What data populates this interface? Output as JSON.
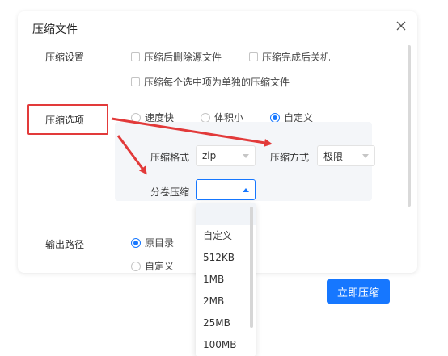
{
  "dialog": {
    "title": "压缩文件",
    "close_icon": "close-icon"
  },
  "settings": {
    "label": "压缩设置",
    "checkboxes": [
      {
        "label": "压缩后删除源文件",
        "checked": false
      },
      {
        "label": "压缩完成后关机",
        "checked": false
      },
      {
        "label": "压缩每个选中项为单独的压缩文件",
        "checked": false
      }
    ]
  },
  "options": {
    "label": "压缩选项",
    "radios": [
      {
        "label": "速度快",
        "selected": false
      },
      {
        "label": "体积小",
        "selected": false
      },
      {
        "label": "自定义",
        "selected": true
      }
    ],
    "format_label": "压缩格式",
    "format_value": "zip",
    "method_label": "压缩方式",
    "method_value": "极限",
    "split_label": "分卷压缩",
    "split_value": ""
  },
  "split_dropdown": {
    "items": [
      "",
      "自定义",
      "512KB",
      "1MB",
      "2MB",
      "25MB",
      "100MB"
    ]
  },
  "output": {
    "label": "输出路径",
    "radios": [
      {
        "label": "原目录",
        "selected": true
      },
      {
        "label": "自定义",
        "selected": false
      }
    ]
  },
  "actions": {
    "compress_now": "立即压缩"
  },
  "colors": {
    "accent": "#1677ff",
    "annotation_red": "#e23a3a"
  }
}
